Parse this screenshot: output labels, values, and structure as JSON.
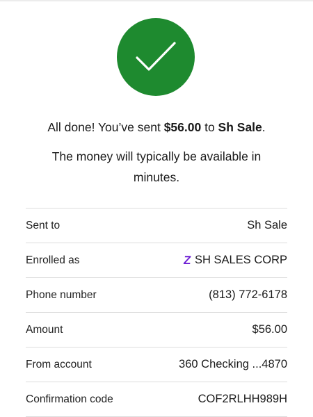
{
  "colors": {
    "success": "#1e8a2f",
    "zelle_purple": "#6d1ed4",
    "divider": "#dcdcdc"
  },
  "confirmation": {
    "done_prefix": "All done! You’ve sent ",
    "amount": "$56.00",
    "to_word": " to ",
    "recipient": "Sh Sale",
    "period": ".",
    "availability": "The money will typically be available in minutes."
  },
  "details": [
    {
      "label": "Sent to",
      "value": "Sh Sale"
    },
    {
      "label": "Enrolled as",
      "icon": "zelle-icon",
      "icon_glyph": "Z",
      "value": "SH SALES CORP"
    },
    {
      "label": "Phone number",
      "value": "(813) 772-6178"
    },
    {
      "label": "Amount",
      "value": "$56.00"
    },
    {
      "label": "From account",
      "value": "360 Checking ...4870"
    },
    {
      "label": "Confirmation code",
      "value": "COF2RLHH989H"
    }
  ]
}
